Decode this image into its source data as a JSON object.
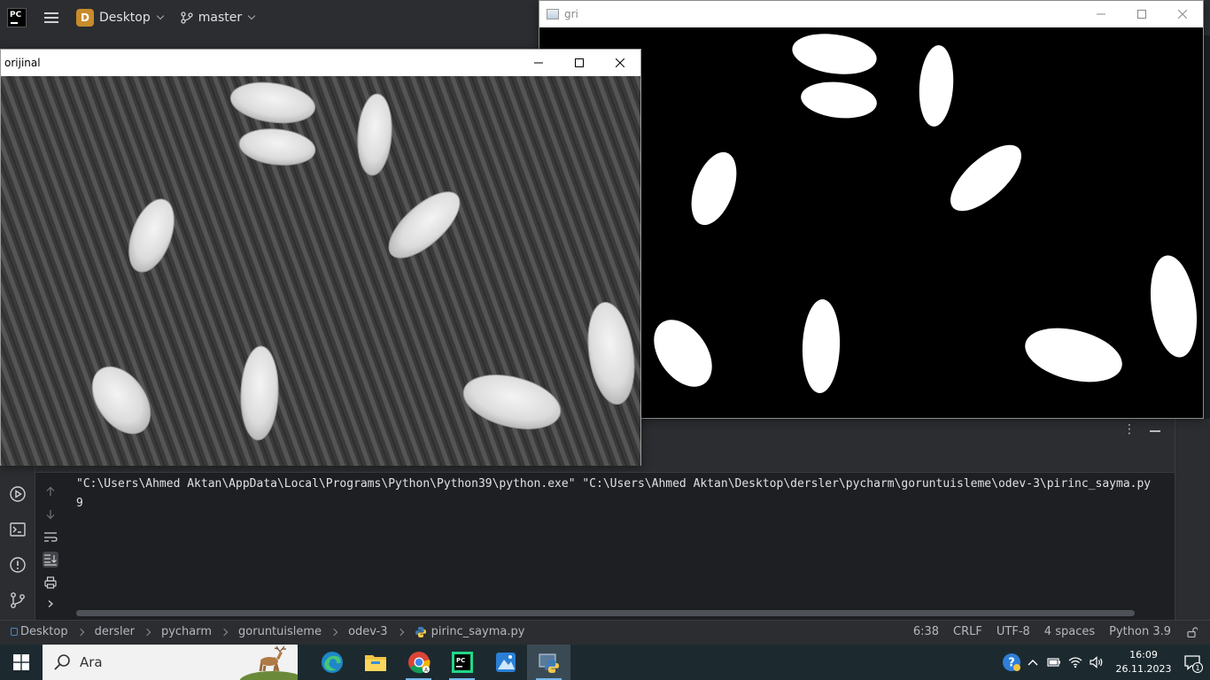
{
  "ide": {
    "project_initial": "D",
    "project_name": "Desktop",
    "branch_name": "master"
  },
  "windows": {
    "orijinal": {
      "title": "orijinal"
    },
    "gri": {
      "title": "gri"
    }
  },
  "console": {
    "command_line": "\"C:\\Users\\Ahmed Aktan\\AppData\\Local\\Programs\\Python\\Python39\\python.exe\" \"C:\\Users\\Ahmed Aktan\\Desktop\\dersler\\pycharm\\goruntuisleme\\odev-3\\pirinc_sayma.py",
    "output": "9"
  },
  "status_bar": {
    "breadcrumbs": [
      "Desktop",
      "dersler",
      "pycharm",
      "goruntuisleme",
      "odev-3",
      "pirinc_sayma.py"
    ],
    "position": "6:38",
    "line_ending": "CRLF",
    "encoding": "UTF-8",
    "indent": "4 spaces",
    "interpreter": "Python 3.9"
  },
  "taskbar": {
    "search_placeholder": "Ara",
    "time": "16:09",
    "date": "26.11.2023",
    "notification_count": "1",
    "pinned_apps": [
      "edge-icon",
      "file-explorer-icon",
      "chrome-icon",
      "pycharm-icon",
      "photos-icon",
      "python-icon"
    ]
  },
  "colors": {
    "ide_bg": "#1e1f22",
    "ide_panel": "#2b2d30",
    "taskbar_bg": "#1c2a30",
    "accent_blue": "#4a88c7",
    "project_badge": "#c78b2c"
  }
}
